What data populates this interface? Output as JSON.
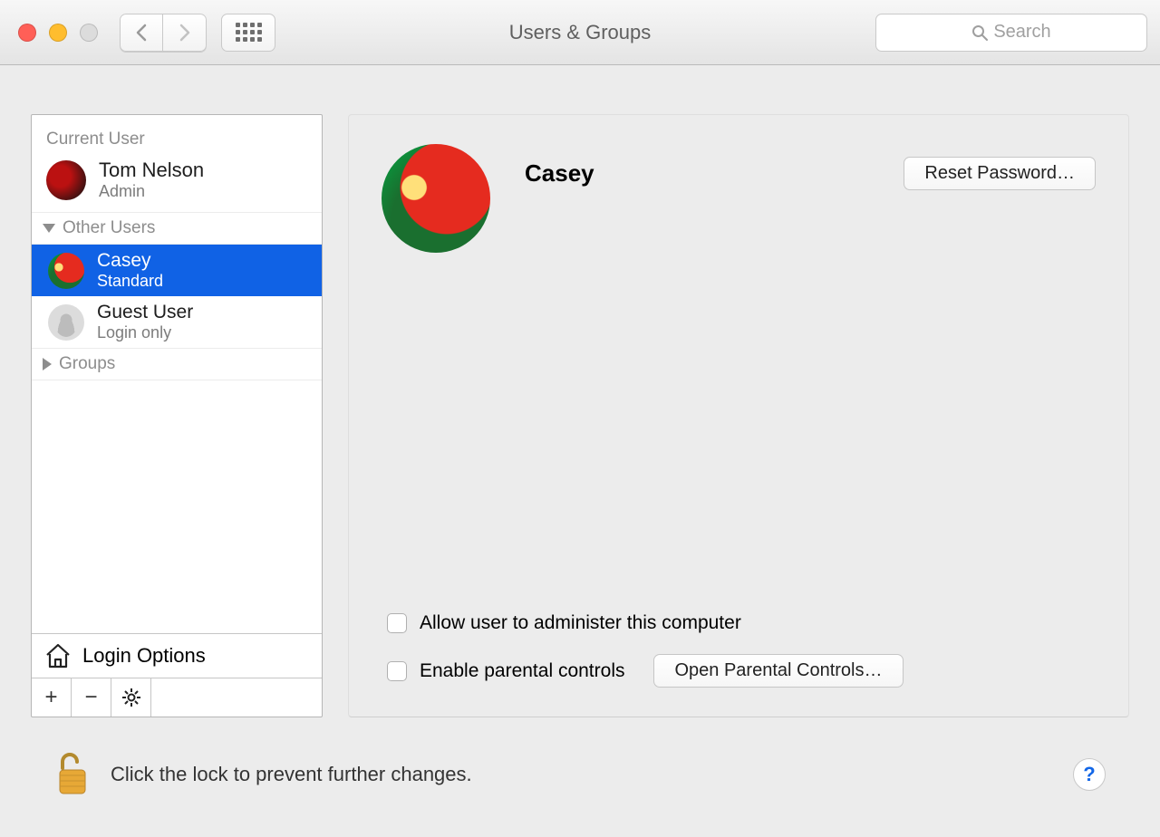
{
  "window": {
    "title": "Users & Groups"
  },
  "search": {
    "placeholder": "Search"
  },
  "sidebar": {
    "current_label": "Current User",
    "current_user": {
      "name": "Tom Nelson",
      "role": "Admin"
    },
    "other_label": "Other Users",
    "users": [
      {
        "name": "Casey",
        "role": "Standard"
      },
      {
        "name": "Guest User",
        "role": "Login only"
      }
    ],
    "groups_label": "Groups",
    "login_options_label": "Login Options"
  },
  "main": {
    "user_name": "Casey",
    "reset_button": "Reset Password…",
    "admin_checkbox_label": "Allow user to administer this computer",
    "parental_checkbox_label": "Enable parental controls",
    "parental_button": "Open Parental Controls…"
  },
  "footer": {
    "lock_text": "Click the lock to prevent further changes.",
    "help_label": "?"
  }
}
